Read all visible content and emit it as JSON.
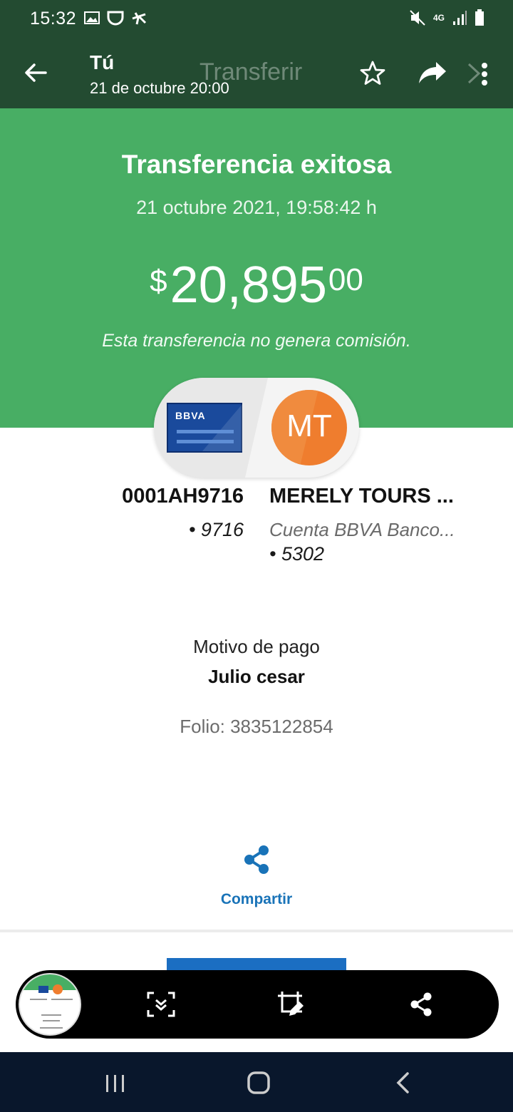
{
  "status_bar": {
    "time": "15:32",
    "network": "4G",
    "left_icons": [
      "gallery-icon",
      "shield-icon",
      "airplane-icon"
    ],
    "right_icons": [
      "mute-icon",
      "network-4g-icon",
      "signal-icon",
      "battery-icon"
    ]
  },
  "header": {
    "title": "Tú",
    "subtitle": "21 de octubre 20:00",
    "background_title": "Transferir",
    "color": "#234b31"
  },
  "success": {
    "title": "Transferencia exitosa",
    "date": "21 octubre 2021, 19:58:42 h",
    "amount_currency": "$",
    "amount_main": "20,895",
    "amount_cents": "00",
    "commission_note": "Esta transferencia no genera comisión.",
    "color": "#48ae64"
  },
  "origin": {
    "card_brand": "BBVA",
    "name": "0001AH9716",
    "number": "• 9716"
  },
  "destination": {
    "initials": "MT",
    "name": "MERELY TOURS ...",
    "bank": "Cuenta BBVA Banco...",
    "number": "• 5302",
    "avatar_color": "#ef7d2e"
  },
  "details": {
    "motive_label": "Motivo de pago",
    "motive_value": "Julio cesar",
    "folio": "Folio: 3835122854"
  },
  "share": {
    "label": "Compartir",
    "color": "#1973b8"
  },
  "toolbar": {
    "tools": [
      "scroll-capture-icon",
      "crop-edit-icon",
      "share-icon"
    ]
  }
}
